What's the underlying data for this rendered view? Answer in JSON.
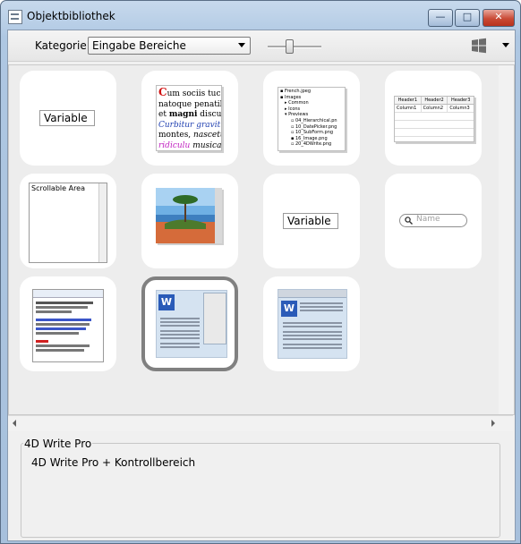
{
  "window": {
    "title": "Objektbibliothek",
    "minimize": "—",
    "maximize": "□",
    "close": "✕"
  },
  "toolbar": {
    "category_label": "Kategorie:",
    "category_value": "Eingabe Bereiche",
    "zoom_level": 0.4,
    "platform_icon": "windows-icon"
  },
  "library": {
    "items": [
      {
        "kind": "variable",
        "text": "Variable"
      },
      {
        "kind": "styled-text",
        "lines": [
          "Cum sociis tuc",
          "natoque penatibi",
          "et magni discuri",
          "Curbitur gravit",
          "montes, nascetur",
          "ridiculu musicae"
        ]
      },
      {
        "kind": "hierarchical-list",
        "rows": [
          "French.jpeg",
          "Images",
          "Common",
          "Icons",
          "Previews",
          "04_Hierarchical.pn",
          "10_DatePicker.png",
          "10_SubForm.png",
          "16_Image.png",
          "20_4DWrite.png"
        ]
      },
      {
        "kind": "listbox",
        "headers": [
          "Header1",
          "Header2",
          "Header3"
        ],
        "columns": [
          "Column1",
          "Column2",
          "Column3"
        ]
      },
      {
        "kind": "scrollable-area",
        "text": "Scrollable Area"
      },
      {
        "kind": "picture"
      },
      {
        "kind": "variable",
        "text": "Variable"
      },
      {
        "kind": "search-field",
        "placeholder": "Name"
      },
      {
        "kind": "text-with-toolbar"
      },
      {
        "kind": "4d-write-pro-panel",
        "selected": true
      },
      {
        "kind": "4d-write-pro"
      }
    ]
  },
  "properties": {
    "group_title": "4D Write Pro",
    "description": "4D Write Pro + Kontrollbereich"
  }
}
